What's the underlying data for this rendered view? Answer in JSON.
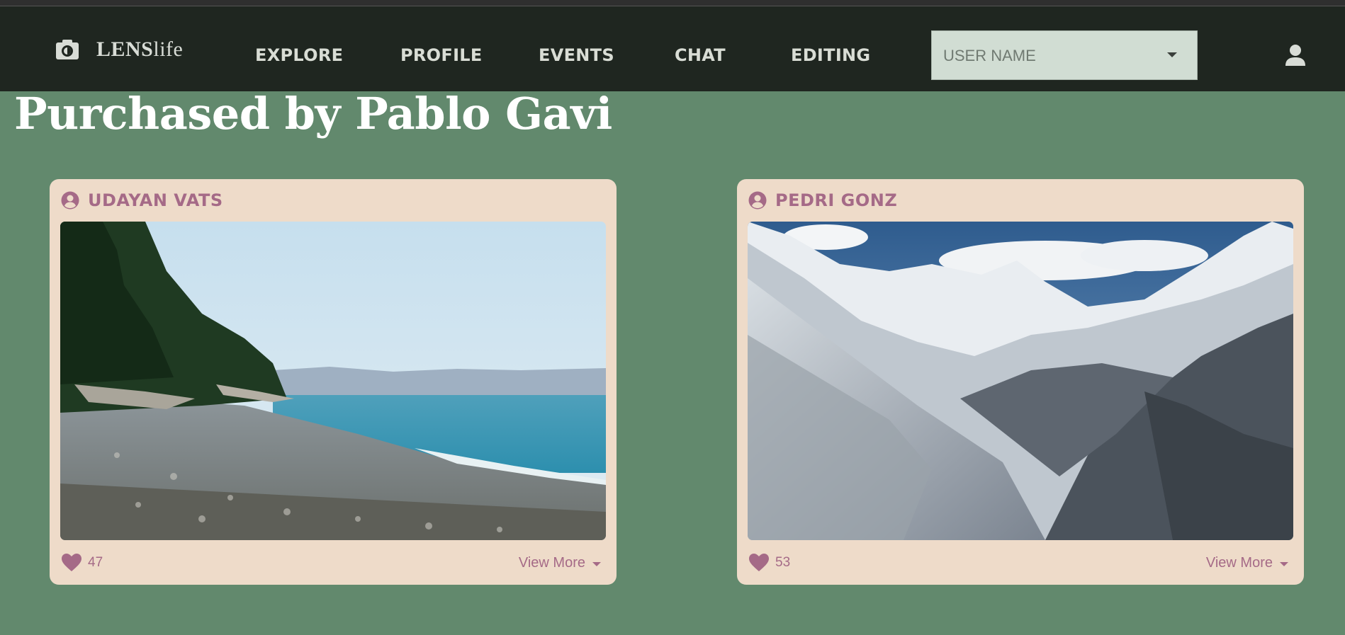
{
  "brand": {
    "bold": "LENS",
    "light": "life"
  },
  "nav": {
    "explore": "EXPLORE",
    "profile": "PROFILE",
    "events": "EVENTS",
    "chat": "CHAT",
    "editing": "EDITING"
  },
  "user_select": {
    "placeholder": "USER NAME"
  },
  "page_title": "Purchased by Pablo Gavi",
  "cards": [
    {
      "user": "UDAYAN VATS",
      "likes": "47",
      "view_more": "View More",
      "image": "beach-landscape"
    },
    {
      "user": "PEDRI GONZ",
      "likes": "53",
      "view_more": "View More",
      "image": "snowy-mountains"
    }
  ],
  "colors": {
    "navbar": "#1f2620",
    "background": "#62896d",
    "card": "#eedbc9",
    "accent": "#a56a87"
  }
}
